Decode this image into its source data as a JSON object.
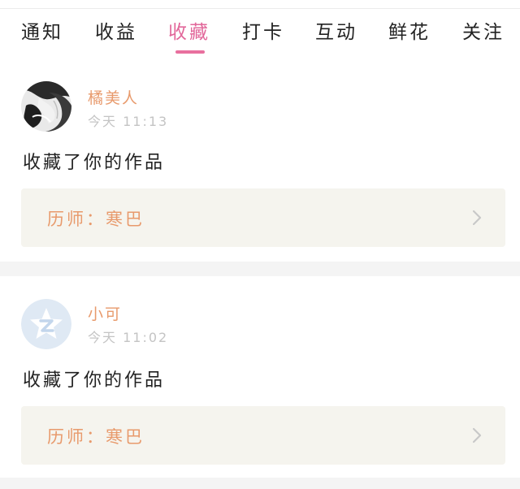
{
  "tabs": [
    {
      "label": "通知"
    },
    {
      "label": "收益"
    },
    {
      "label": "收藏",
      "active": true
    },
    {
      "label": "打卡"
    },
    {
      "label": "互动"
    },
    {
      "label": "鲜花"
    },
    {
      "label": "关注"
    }
  ],
  "notifications": [
    {
      "username": "橘美人",
      "time": "今天 11:13",
      "action": "收藏了你的作品",
      "work_title": "历师：寒巴",
      "avatar_icon": "ink-painting-avatar"
    },
    {
      "username": "小可",
      "time": "今天 11:02",
      "action": "收藏了你的作品",
      "work_title": "历师：寒巴",
      "avatar_icon": "qzone-star-avatar"
    }
  ],
  "colors": {
    "accent": "#e2679a",
    "username": "#e89a6c",
    "work_box_bg": "#f5f4ee",
    "time": "#c4c4c4"
  }
}
